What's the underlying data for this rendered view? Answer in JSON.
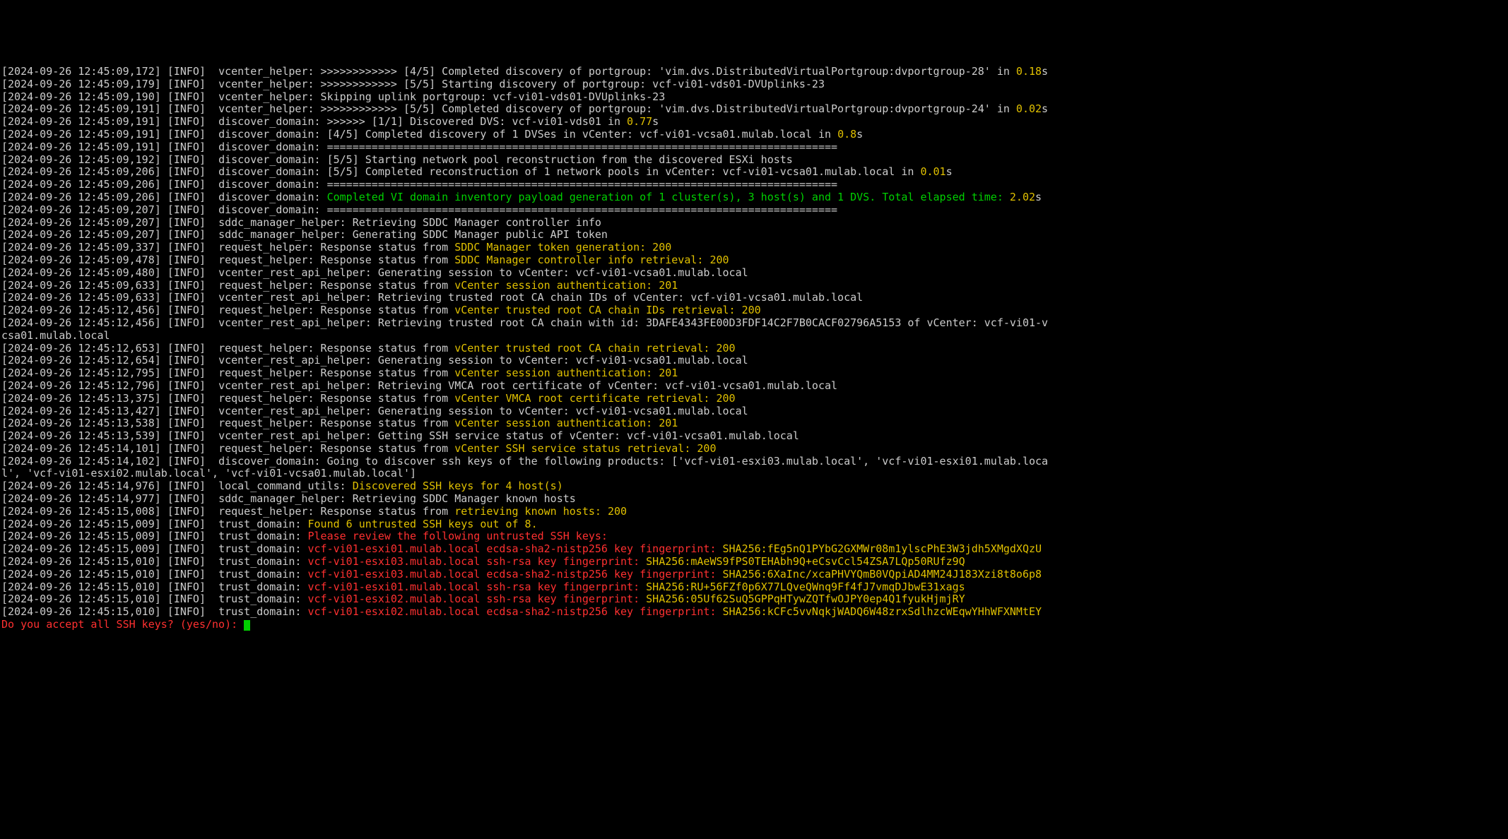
{
  "lines": [
    {
      "ts": "[2024-09-26 12:45:09,172]",
      "lvl": "[INFO]",
      "mod": "vcenter_helper:",
      "segs": [
        {
          "c": "txt",
          "t": " >>>>>>>>>>>> [4/5] Completed discovery of portgroup: 'vim.dvs.DistributedVirtualPortgroup:dvportgroup-28' in "
        },
        {
          "c": "yel",
          "t": "0.18"
        },
        {
          "c": "txt",
          "t": "s"
        }
      ]
    },
    {
      "ts": "[2024-09-26 12:45:09,179]",
      "lvl": "[INFO]",
      "mod": "vcenter_helper:",
      "segs": [
        {
          "c": "txt",
          "t": " >>>>>>>>>>>> [5/5] Starting discovery of portgroup: vcf-vi01-vds01-DVUplinks-23"
        }
      ]
    },
    {
      "ts": "[2024-09-26 12:45:09,190]",
      "lvl": "[INFO]",
      "mod": "vcenter_helper:",
      "segs": [
        {
          "c": "txt",
          "t": " Skipping uplink portgroup: vcf-vi01-vds01-DVUplinks-23"
        }
      ]
    },
    {
      "ts": "[2024-09-26 12:45:09,191]",
      "lvl": "[INFO]",
      "mod": "vcenter_helper:",
      "segs": [
        {
          "c": "txt",
          "t": " >>>>>>>>>>>> [5/5] Completed discovery of portgroup: 'vim.dvs.DistributedVirtualPortgroup:dvportgroup-24' in "
        },
        {
          "c": "yel",
          "t": "0.02"
        },
        {
          "c": "txt",
          "t": "s"
        }
      ]
    },
    {
      "ts": "[2024-09-26 12:45:09,191]",
      "lvl": "[INFO]",
      "mod": "discover_domain:",
      "segs": [
        {
          "c": "txt",
          "t": " >>>>>> [1/1] Discovered DVS: vcf-vi01-vds01 in "
        },
        {
          "c": "yel",
          "t": "0.77"
        },
        {
          "c": "txt",
          "t": "s"
        }
      ]
    },
    {
      "ts": "[2024-09-26 12:45:09,191]",
      "lvl": "[INFO]",
      "mod": "discover_domain:",
      "segs": [
        {
          "c": "txt",
          "t": " [4/5] Completed discovery of 1 DVSes in vCenter: vcf-vi01-vcsa01.mulab.local in "
        },
        {
          "c": "yel",
          "t": "0.8"
        },
        {
          "c": "txt",
          "t": "s"
        }
      ]
    },
    {
      "ts": "[2024-09-26 12:45:09,191]",
      "lvl": "[INFO]",
      "mod": "discover_domain:",
      "segs": [
        {
          "c": "txt",
          "t": " ================================================================================"
        }
      ]
    },
    {
      "ts": "[2024-09-26 12:45:09,192]",
      "lvl": "[INFO]",
      "mod": "discover_domain:",
      "segs": [
        {
          "c": "txt",
          "t": " [5/5] Starting network pool reconstruction from the discovered ESXi hosts"
        }
      ]
    },
    {
      "ts": "[2024-09-26 12:45:09,206]",
      "lvl": "[INFO]",
      "mod": "discover_domain:",
      "segs": [
        {
          "c": "txt",
          "t": " [5/5] Completed reconstruction of 1 network pools in vCenter: vcf-vi01-vcsa01.mulab.local in "
        },
        {
          "c": "yel",
          "t": "0.01"
        },
        {
          "c": "txt",
          "t": "s"
        }
      ]
    },
    {
      "ts": "[2024-09-26 12:45:09,206]",
      "lvl": "[INFO]",
      "mod": "discover_domain:",
      "segs": [
        {
          "c": "txt",
          "t": " ================================================================================"
        }
      ]
    },
    {
      "ts": "[2024-09-26 12:45:09,206]",
      "lvl": "[INFO]",
      "mod": "discover_domain:",
      "segs": [
        {
          "c": "txt",
          "t": " "
        },
        {
          "c": "grn",
          "t": "Completed VI domain inventory payload generation of 1 cluster(s), 3 host(s) and 1 DVS. Total elapsed time: "
        },
        {
          "c": "yel",
          "t": "2.02"
        },
        {
          "c": "txt",
          "t": "s"
        }
      ]
    },
    {
      "ts": "[2024-09-26 12:45:09,207]",
      "lvl": "[INFO]",
      "mod": "discover_domain:",
      "segs": [
        {
          "c": "txt",
          "t": " ================================================================================"
        }
      ]
    },
    {
      "ts": "[2024-09-26 12:45:09,207]",
      "lvl": "[INFO]",
      "mod": "sddc_manager_helper:",
      "segs": [
        {
          "c": "txt",
          "t": " Retrieving SDDC Manager controller info"
        }
      ]
    },
    {
      "ts": "[2024-09-26 12:45:09,207]",
      "lvl": "[INFO]",
      "mod": "sddc_manager_helper:",
      "segs": [
        {
          "c": "txt",
          "t": " Generating SDDC Manager public API token"
        }
      ]
    },
    {
      "ts": "[2024-09-26 12:45:09,337]",
      "lvl": "[INFO]",
      "mod": "request_helper:",
      "segs": [
        {
          "c": "txt",
          "t": " Response status from "
        },
        {
          "c": "yel",
          "t": "SDDC Manager token generation: 200"
        }
      ]
    },
    {
      "ts": "[2024-09-26 12:45:09,478]",
      "lvl": "[INFO]",
      "mod": "request_helper:",
      "segs": [
        {
          "c": "txt",
          "t": " Response status from "
        },
        {
          "c": "yel",
          "t": "SDDC Manager controller info retrieval: 200"
        }
      ]
    },
    {
      "ts": "[2024-09-26 12:45:09,480]",
      "lvl": "[INFO]",
      "mod": "vcenter_rest_api_helper:",
      "segs": [
        {
          "c": "txt",
          "t": " Generating session to vCenter: vcf-vi01-vcsa01.mulab.local"
        }
      ]
    },
    {
      "ts": "[2024-09-26 12:45:09,633]",
      "lvl": "[INFO]",
      "mod": "request_helper:",
      "segs": [
        {
          "c": "txt",
          "t": " Response status from "
        },
        {
          "c": "yel",
          "t": "vCenter session authentication: 201"
        }
      ]
    },
    {
      "ts": "[2024-09-26 12:45:09,633]",
      "lvl": "[INFO]",
      "mod": "vcenter_rest_api_helper:",
      "segs": [
        {
          "c": "txt",
          "t": " Retrieving trusted root CA chain IDs of vCenter: vcf-vi01-vcsa01.mulab.local"
        }
      ]
    },
    {
      "ts": "[2024-09-26 12:45:12,456]",
      "lvl": "[INFO]",
      "mod": "request_helper:",
      "segs": [
        {
          "c": "txt",
          "t": " Response status from "
        },
        {
          "c": "yel",
          "t": "vCenter trusted root CA chain IDs retrieval: 200"
        }
      ]
    },
    {
      "ts": "[2024-09-26 12:45:12,456]",
      "lvl": "[INFO]",
      "mod": "vcenter_rest_api_helper:",
      "segs": [
        {
          "c": "txt",
          "t": " Retrieving trusted root CA chain with id: 3DAFE4343FE00D3FDF14C2F7B0CACF02796A5153 of vCenter: vcf-vi01-v"
        }
      ]
    },
    {
      "ts": "",
      "lvl": "",
      "mod": "",
      "segs": [
        {
          "c": "txt",
          "t": "csa01.mulab.local"
        }
      ]
    },
    {
      "ts": "[2024-09-26 12:45:12,653]",
      "lvl": "[INFO]",
      "mod": "request_helper:",
      "segs": [
        {
          "c": "txt",
          "t": " Response status from "
        },
        {
          "c": "yel",
          "t": "vCenter trusted root CA chain retrieval: 200"
        }
      ]
    },
    {
      "ts": "[2024-09-26 12:45:12,654]",
      "lvl": "[INFO]",
      "mod": "vcenter_rest_api_helper:",
      "segs": [
        {
          "c": "txt",
          "t": " Generating session to vCenter: vcf-vi01-vcsa01.mulab.local"
        }
      ]
    },
    {
      "ts": "[2024-09-26 12:45:12,795]",
      "lvl": "[INFO]",
      "mod": "request_helper:",
      "segs": [
        {
          "c": "txt",
          "t": " Response status from "
        },
        {
          "c": "yel",
          "t": "vCenter session authentication: 201"
        }
      ]
    },
    {
      "ts": "[2024-09-26 12:45:12,796]",
      "lvl": "[INFO]",
      "mod": "vcenter_rest_api_helper:",
      "segs": [
        {
          "c": "txt",
          "t": " Retrieving VMCA root certificate of vCenter: vcf-vi01-vcsa01.mulab.local"
        }
      ]
    },
    {
      "ts": "[2024-09-26 12:45:13,375]",
      "lvl": "[INFO]",
      "mod": "request_helper:",
      "segs": [
        {
          "c": "txt",
          "t": " Response status from "
        },
        {
          "c": "yel",
          "t": "vCenter VMCA root certificate retrieval: 200"
        }
      ]
    },
    {
      "ts": "[2024-09-26 12:45:13,427]",
      "lvl": "[INFO]",
      "mod": "vcenter_rest_api_helper:",
      "segs": [
        {
          "c": "txt",
          "t": " Generating session to vCenter: vcf-vi01-vcsa01.mulab.local"
        }
      ]
    },
    {
      "ts": "[2024-09-26 12:45:13,538]",
      "lvl": "[INFO]",
      "mod": "request_helper:",
      "segs": [
        {
          "c": "txt",
          "t": " Response status from "
        },
        {
          "c": "yel",
          "t": "vCenter session authentication: 201"
        }
      ]
    },
    {
      "ts": "[2024-09-26 12:45:13,539]",
      "lvl": "[INFO]",
      "mod": "vcenter_rest_api_helper:",
      "segs": [
        {
          "c": "txt",
          "t": " Getting SSH service status of vCenter: vcf-vi01-vcsa01.mulab.local"
        }
      ]
    },
    {
      "ts": "[2024-09-26 12:45:14,101]",
      "lvl": "[INFO]",
      "mod": "request_helper:",
      "segs": [
        {
          "c": "txt",
          "t": " Response status from "
        },
        {
          "c": "yel",
          "t": "vCenter SSH service status retrieval: 200"
        }
      ]
    },
    {
      "ts": "[2024-09-26 12:45:14,102]",
      "lvl": "[INFO]",
      "mod": "discover_domain:",
      "segs": [
        {
          "c": "txt",
          "t": " Going to discover ssh keys of the following products: ['vcf-vi01-esxi03.mulab.local', 'vcf-vi01-esxi01.mulab.loca"
        }
      ]
    },
    {
      "ts": "",
      "lvl": "",
      "mod": "",
      "segs": [
        {
          "c": "txt",
          "t": "l', 'vcf-vi01-esxi02.mulab.local', 'vcf-vi01-vcsa01.mulab.local']"
        }
      ]
    },
    {
      "ts": "[2024-09-26 12:45:14,976]",
      "lvl": "[INFO]",
      "mod": "local_command_utils:",
      "segs": [
        {
          "c": "txt",
          "t": " "
        },
        {
          "c": "yel",
          "t": "Discovered SSH keys for 4 host(s)"
        }
      ]
    },
    {
      "ts": "[2024-09-26 12:45:14,977]",
      "lvl": "[INFO]",
      "mod": "sddc_manager_helper:",
      "segs": [
        {
          "c": "txt",
          "t": " Retrieving SDDC Manager known hosts"
        }
      ]
    },
    {
      "ts": "[2024-09-26 12:45:15,008]",
      "lvl": "[INFO]",
      "mod": "request_helper:",
      "segs": [
        {
          "c": "txt",
          "t": " Response status from "
        },
        {
          "c": "yel",
          "t": "retrieving known hosts: 200"
        }
      ]
    },
    {
      "ts": "[2024-09-26 12:45:15,009]",
      "lvl": "[INFO]",
      "mod": "trust_domain:",
      "segs": [
        {
          "c": "txt",
          "t": " "
        },
        {
          "c": "yel",
          "t": "Found 6 untrusted SSH keys out of 8."
        }
      ]
    },
    {
      "ts": "[2024-09-26 12:45:15,009]",
      "lvl": "[INFO]",
      "mod": "trust_domain:",
      "segs": [
        {
          "c": "txt",
          "t": " "
        },
        {
          "c": "red",
          "t": "Please review the following untrusted SSH keys:"
        }
      ]
    },
    {
      "ts": "[2024-09-26 12:45:15,009]",
      "lvl": "[INFO]",
      "mod": "trust_domain:",
      "segs": [
        {
          "c": "txt",
          "t": " "
        },
        {
          "c": "red",
          "t": "vcf-vi01-esxi01.mulab.local ecdsa-sha2-nistp256 key fingerprint: "
        },
        {
          "c": "yel",
          "t": "SHA256:fEg5nQ1PYbG2GXMWr08m1ylscPhE3W3jdh5XMgdXQzU"
        }
      ]
    },
    {
      "ts": "[2024-09-26 12:45:15,010]",
      "lvl": "[INFO]",
      "mod": "trust_domain:",
      "segs": [
        {
          "c": "txt",
          "t": " "
        },
        {
          "c": "red",
          "t": "vcf-vi01-esxi03.mulab.local ssh-rsa key fingerprint: "
        },
        {
          "c": "yel",
          "t": "SHA256:mAeWS9fPS0TEHAbh9Q+eCsvCcl54ZSA7LQp50RUfz9Q"
        }
      ]
    },
    {
      "ts": "[2024-09-26 12:45:15,010]",
      "lvl": "[INFO]",
      "mod": "trust_domain:",
      "segs": [
        {
          "c": "txt",
          "t": " "
        },
        {
          "c": "red",
          "t": "vcf-vi01-esxi03.mulab.local ecdsa-sha2-nistp256 key fingerprint: "
        },
        {
          "c": "yel",
          "t": "SHA256:6XaInc/xcaPHVYQmB0VQpiAD4MM24J183Xzi8t8o6p8"
        }
      ]
    },
    {
      "ts": "[2024-09-26 12:45:15,010]",
      "lvl": "[INFO]",
      "mod": "trust_domain:",
      "segs": [
        {
          "c": "txt",
          "t": " "
        },
        {
          "c": "red",
          "t": "vcf-vi01-esxi01.mulab.local ssh-rsa key fingerprint: "
        },
        {
          "c": "yel",
          "t": "SHA256:RU+56FZf0p6X77LQveQWnq9Ff4fJ7vmqDJbwE31xags"
        }
      ]
    },
    {
      "ts": "[2024-09-26 12:45:15,010]",
      "lvl": "[INFO]",
      "mod": "trust_domain:",
      "segs": [
        {
          "c": "txt",
          "t": " "
        },
        {
          "c": "red",
          "t": "vcf-vi01-esxi02.mulab.local ssh-rsa key fingerprint: "
        },
        {
          "c": "yel",
          "t": "SHA256:05Uf62SuQ5GPPqHTywZQTfwOJPY0ep4Q1fyukHjmjRY"
        }
      ]
    },
    {
      "ts": "[2024-09-26 12:45:15,010]",
      "lvl": "[INFO]",
      "mod": "trust_domain:",
      "segs": [
        {
          "c": "txt",
          "t": " "
        },
        {
          "c": "red",
          "t": "vcf-vi01-esxi02.mulab.local ecdsa-sha2-nistp256 key fingerprint: "
        },
        {
          "c": "yel",
          "t": "SHA256:kCFc5vvNqkjWADQ6W48zrxSdlhzcWEqwYHhWFXNMtEY"
        }
      ]
    }
  ],
  "prompt": "Do you accept all SSH keys? (yes/no): "
}
